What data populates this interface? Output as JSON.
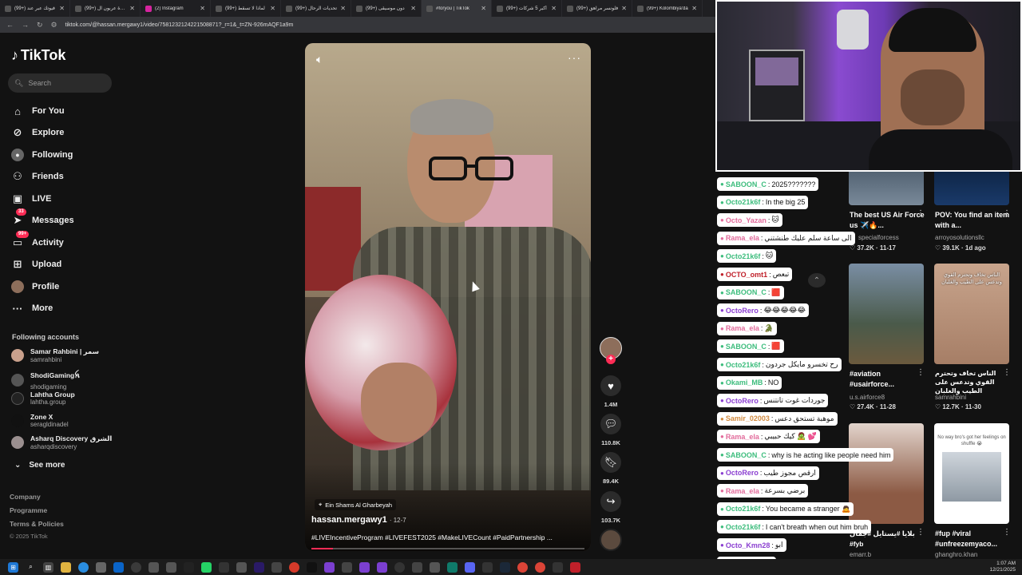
{
  "browser": {
    "tabs": [
      {
        "label": "(99+) فيوتك عبر عند"
      },
      {
        "label": "(99+) عادة عربون ال"
      },
      {
        "label": "(2) Instagram"
      },
      {
        "label": "(99+) لماذا لا تسقط"
      },
      {
        "label": "(99+) تحديات الرحال"
      },
      {
        "label": "(99+) دون موسيقى"
      },
      {
        "label": "#foryou | TikTok"
      },
      {
        "label": "(99+) أكبر 5 شركات"
      },
      {
        "label": "(99+) فلونسر مراهق"
      },
      {
        "label": "(99+) Kolombiya'da"
      }
    ],
    "url": "tiktok.com/@hassan.mergawy1/video/7581232124221508871?_r=1&_t=ZN-926mAQF1a9m"
  },
  "sidebar": {
    "logo": "TikTok",
    "search_placeholder": "Search",
    "nav": [
      {
        "label": "For You",
        "icon": "home-icon"
      },
      {
        "label": "Explore",
        "icon": "compass-icon"
      },
      {
        "label": "Following",
        "icon": "following-icon"
      },
      {
        "label": "Friends",
        "icon": "friends-icon"
      },
      {
        "label": "LIVE",
        "icon": "live-icon"
      },
      {
        "label": "Messages",
        "icon": "messages-icon",
        "badge": "33"
      },
      {
        "label": "Activity",
        "icon": "activity-icon",
        "badge": "99+"
      },
      {
        "label": "Upload",
        "icon": "upload-icon"
      },
      {
        "label": "Profile",
        "icon": "profile-icon"
      },
      {
        "label": "More",
        "icon": "more-icon"
      }
    ],
    "following_title": "Following accounts",
    "accounts": [
      {
        "name": "Samar Rahbini | سمر",
        "handle": "samrahbini"
      },
      {
        "name": "ShodiGamingꫝ",
        "handle": "shodigaming"
      },
      {
        "name": "Lahtha Group",
        "handle": "lahtha.group"
      },
      {
        "name": "Zone X",
        "handle": "seragldinadel"
      },
      {
        "name": "Asharq Discovery الشرق",
        "handle": "asharqdiscovery"
      }
    ],
    "see_more": "See more",
    "footer": [
      "Company",
      "Programme",
      "Terms & Policies"
    ],
    "copyright": "© 2025 TikTok"
  },
  "video": {
    "location": "Ein Shams Al Gharbeyah",
    "author": "hassan.mergawy1",
    "date": "· 12-7",
    "caption": "#LIVEIncentiveProgram #LIVEFEST2025 #MakeLIVECount #PaidPartnership ...",
    "progress": 0.08,
    "likes": "1.4M",
    "comments": "110.8K",
    "saves": "89.4K",
    "shares": "103.7K"
  },
  "chat": [
    {
      "user": "SABOON_C",
      "msg": "2025???????",
      "color": "#3dbd7d"
    },
    {
      "user": "Octo21k6f",
      "msg": "In the big 25",
      "color": "#3dbd7d"
    },
    {
      "user": "Octo_Yazan",
      "msg": "🐱",
      "color": "#e26b9b"
    },
    {
      "user": "Rama_ela",
      "msg": "الى ساعة سلم عليك طنشتني",
      "color": "#e26b9b"
    },
    {
      "user": "Octo21k6f",
      "msg": "🐱",
      "color": "#3dbd7d"
    },
    {
      "user": "OCTO_omt1",
      "msg": "تبعص",
      "color": "#c0202a"
    },
    {
      "user": "SABOON_C",
      "msg": "🟥",
      "color": "#3dbd7d"
    },
    {
      "user": "OctoRero",
      "msg": "😂😂😂😂😂",
      "color": "#8b3fd1"
    },
    {
      "user": "Rama_ela",
      "msg": "🐊",
      "color": "#e26b9b"
    },
    {
      "user": "SABOON_C",
      "msg": "🟥",
      "color": "#3dbd7d"
    },
    {
      "user": "Octo21k6f",
      "msg": "رح تخسرو مايكل جردون",
      "color": "#3dbd7d"
    },
    {
      "user": "Okami_MB",
      "msg": "NO",
      "color": "#3dbd7d"
    },
    {
      "user": "OctoRero",
      "msg": "جوردات غوت تانتنس",
      "color": "#8b3fd1"
    },
    {
      "user": "Samir_02003",
      "msg": "موهبة تستحق دعس",
      "color": "#d18a3f"
    },
    {
      "user": "Rama_ela",
      "msg": "كيك حبيبي 🧟 💕",
      "color": "#e26b9b"
    },
    {
      "user": "SABOON_C",
      "msg": "why is he acting like people need him",
      "color": "#3dbd7d"
    },
    {
      "user": "OctoRero",
      "msg": "ارقص مجوز طيب",
      "color": "#8b3fd1"
    },
    {
      "user": "Rama_ela",
      "msg": "برضي بسرعة",
      "color": "#e26b9b"
    },
    {
      "user": "Octo21k6f",
      "msg": "You became a stranger 🙇",
      "color": "#3dbd7d"
    },
    {
      "user": "Octo21k6f",
      "msg": "I can't breath when out him bruh",
      "color": "#3dbd7d"
    },
    {
      "user": "Octo_Kmn28",
      "msg": "ابو",
      "color": "#8b3fd1"
    },
    {
      "user": "Octo21k6f",
      "msg": "اي",
      "color": "#3dbd7d"
    }
  ],
  "recommended": [
    {
      "title": "The best US Air Force us ✈️🔥...",
      "author": "specialforcess",
      "likes": "37.2K",
      "date": "11-17"
    },
    {
      "title": "POV: You find an item with a...",
      "author": "arroyosolutionsllc",
      "likes": "39.1K",
      "date": "1d ago"
    },
    {
      "title": "#aviation #usairforce...",
      "author": "u.s.airforce8",
      "likes": "27.4K",
      "date": "11-28"
    },
    {
      "title": "الناس تخاف وتحترم القوي وتدعس على الطيب والغلبان",
      "author": "samrahbini",
      "likes": "12.7K",
      "date": "11-30",
      "overlay": "الناس تخاف وتحترم القوي وتدعس على الطيب والغلبان"
    },
    {
      "title": "بلايا #يستايل #جمال #fyb",
      "author": "emarr.b",
      "likes": "",
      "date": ""
    },
    {
      "title": "#fup #viral #unfreezemyaco...",
      "author": "ghanghro.khan",
      "likes": "",
      "date": "",
      "overlay": "No way bro's got her feelings on shuffle 😭"
    }
  ],
  "taskbar": {
    "time": "1:07 AM",
    "date": "12/21/2025"
  }
}
